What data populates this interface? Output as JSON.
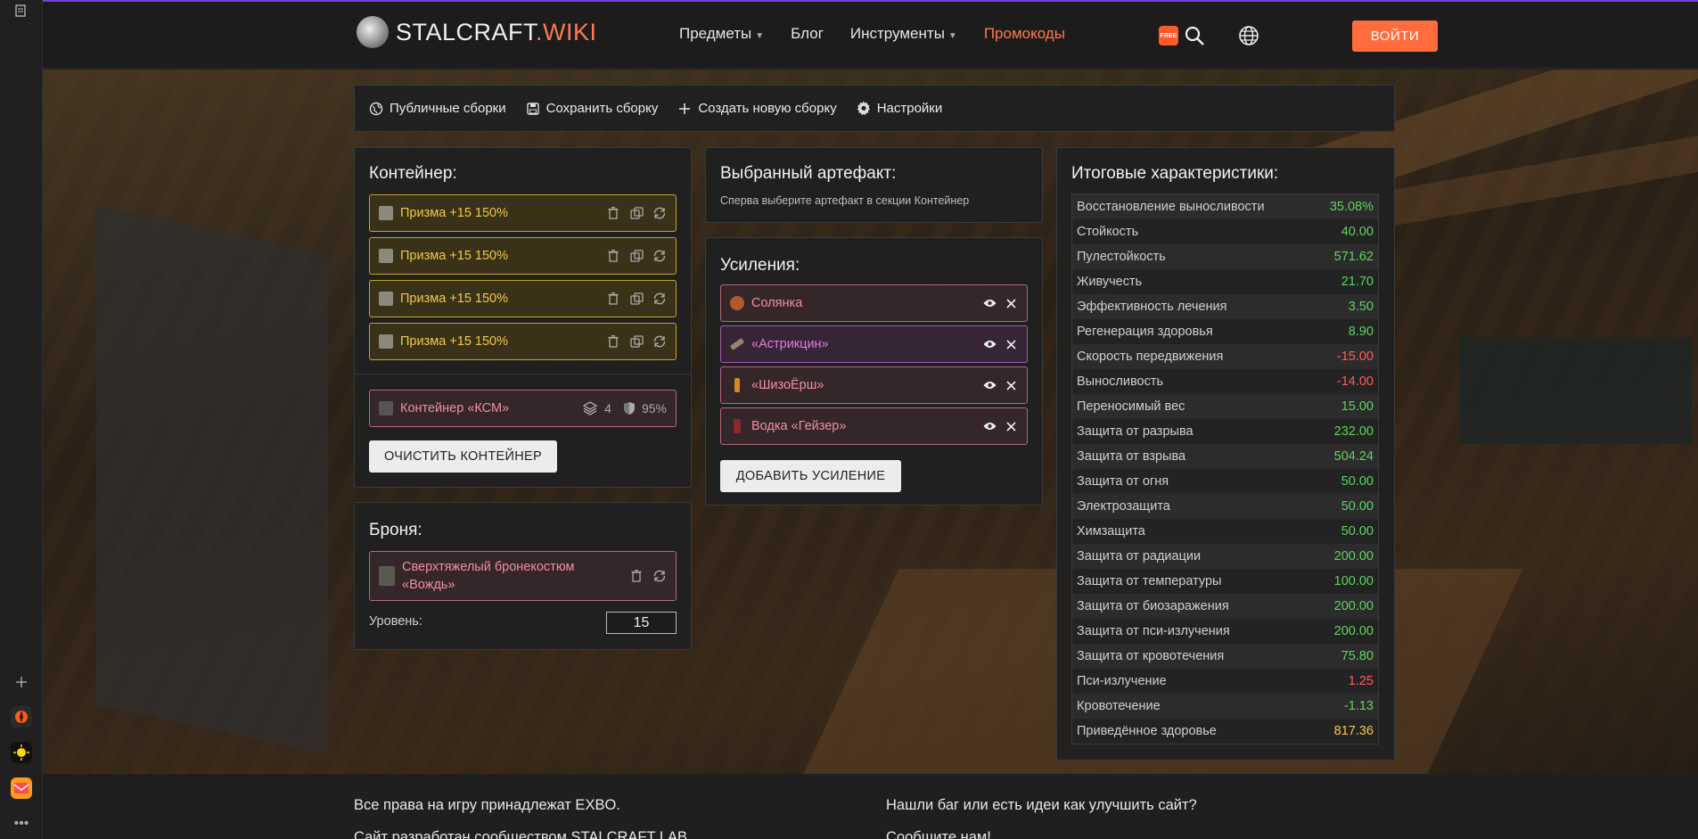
{
  "browser_rail": {
    "icons": [
      "notes-icon",
      "plus-icon",
      "app-icon-1",
      "app-icon-2",
      "app-icon-3",
      "more-icon"
    ]
  },
  "header": {
    "logo_main": "STALCRAFT",
    "logo_accent": ".WIKI",
    "nav": [
      {
        "label": "Предметы",
        "has_caret": true
      },
      {
        "label": "Блог",
        "has_caret": false
      },
      {
        "label": "Инструменты",
        "has_caret": true
      },
      {
        "label": "Промокоды",
        "has_caret": false
      }
    ],
    "free_badge": "FREE",
    "login": "ВОЙТИ"
  },
  "toolbar": {
    "public_builds": "Публичные сборки",
    "save_build": "Сохранить сборку",
    "new_build": "Создать новую сборку",
    "settings": "Настройки"
  },
  "container": {
    "title": "Контейнер:",
    "artifacts": [
      {
        "label": "Призма +15 150%"
      },
      {
        "label": "Призма +15 150%"
      },
      {
        "label": "Призма +15 150%"
      },
      {
        "label": "Призма +15 150%"
      }
    ],
    "container_name": "Контейнер «КСМ»",
    "capacity": "4",
    "protection": "95%",
    "clear_button": "ОЧИСТИТЬ КОНТЕЙНЕР"
  },
  "armor": {
    "title": "Броня:",
    "name_line1": "Сверхтяжелый бронекостюм",
    "name_line2": "«Вождь»",
    "level_label": "Уровень:",
    "level_value": "15"
  },
  "selected_artifact": {
    "title": "Выбранный артефакт:",
    "hint": "Сперва выберите артефакт в секции Контейнер"
  },
  "boosts": {
    "title": "Усиления:",
    "items": [
      {
        "label": "Солянка",
        "style": "pink"
      },
      {
        "label": "«Астрикцин»",
        "style": "purple"
      },
      {
        "label": "«ШизоЁрш»",
        "style": "pink"
      },
      {
        "label": "Водка «Гейзер»",
        "style": "pink"
      }
    ],
    "add_button": "ДОБАВИТЬ УСИЛЕНИЕ"
  },
  "stats": {
    "title": "Итоговые характеристики:",
    "rows": [
      {
        "name": "Восстановление выносливости",
        "value": "35.08%",
        "tone": "pos"
      },
      {
        "name": "Стойкость",
        "value": "40.00",
        "tone": "pos"
      },
      {
        "name": "Пулестойкость",
        "value": "571.62",
        "tone": "pos"
      },
      {
        "name": "Живучесть",
        "value": "21.70",
        "tone": "pos"
      },
      {
        "name": "Эффективность лечения",
        "value": "3.50",
        "tone": "pos"
      },
      {
        "name": "Регенерация здоровья",
        "value": "8.90",
        "tone": "pos"
      },
      {
        "name": "Скорость передвижения",
        "value": "-15.00",
        "tone": "neg"
      },
      {
        "name": "Выносливость",
        "value": "-14.00",
        "tone": "neg"
      },
      {
        "name": "Переносимый вес",
        "value": "15.00",
        "tone": "pos"
      },
      {
        "name": "Защита от разрыва",
        "value": "232.00",
        "tone": "pos"
      },
      {
        "name": "Защита от взрыва",
        "value": "504.24",
        "tone": "pos"
      },
      {
        "name": "Защита от огня",
        "value": "50.00",
        "tone": "pos"
      },
      {
        "name": "Электрозащита",
        "value": "50.00",
        "tone": "pos"
      },
      {
        "name": "Химзащита",
        "value": "50.00",
        "tone": "pos"
      },
      {
        "name": "Защита от радиации",
        "value": "200.00",
        "tone": "pos"
      },
      {
        "name": "Защита от температуры",
        "value": "100.00",
        "tone": "pos"
      },
      {
        "name": "Защита от биозаражения",
        "value": "200.00",
        "tone": "pos"
      },
      {
        "name": "Защита от пси-излучения",
        "value": "200.00",
        "tone": "pos"
      },
      {
        "name": "Защита от кровотечения",
        "value": "75.80",
        "tone": "pos"
      },
      {
        "name": "Пси-излучение",
        "value": "1.25",
        "tone": "neg"
      },
      {
        "name": "Кровотечение",
        "value": "-1.13",
        "tone": "pos"
      },
      {
        "name": "Приведённое здоровье",
        "value": "817.36",
        "tone": "gold"
      }
    ]
  },
  "footer": {
    "rights": "Все права на игру принадлежат EXBO.",
    "bug_prompt": "Нашли баг или есть идеи как улучшить сайт?",
    "dev_line": "Сайт разработан сообществом STALCRAFT LAB",
    "contact": "Сообщите нам!"
  },
  "colors": {
    "accent": "#ff6c3e",
    "positive": "#5ed35e",
    "negative": "#ff5b5b",
    "artifact_gold": "#f0c84a"
  }
}
